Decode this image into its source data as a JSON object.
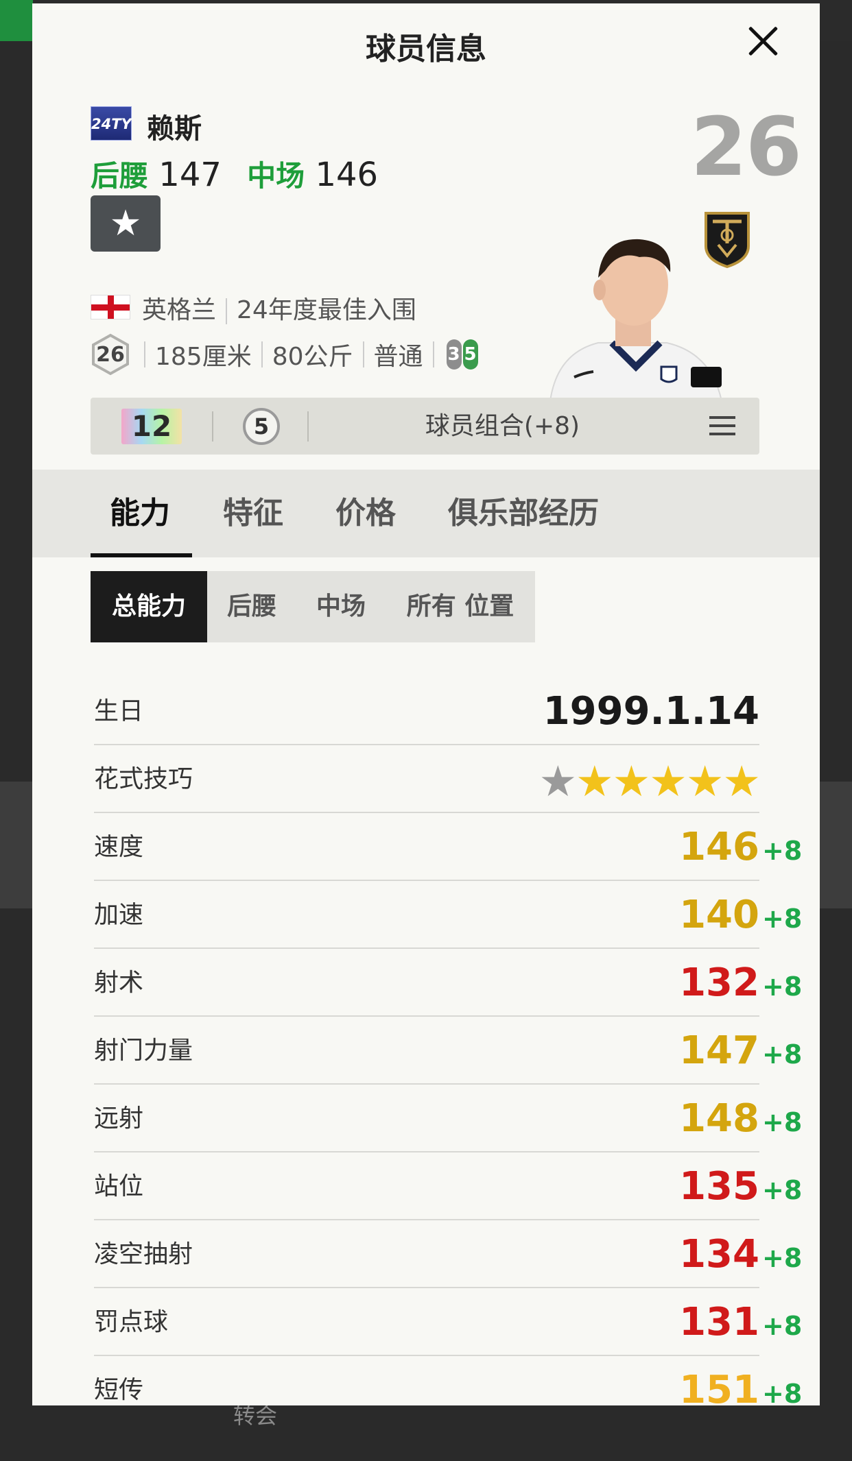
{
  "header": {
    "title": "球员信息"
  },
  "player": {
    "season_badge": "24TY",
    "name": "赖斯",
    "positions": [
      {
        "label": "后腰",
        "value": "147"
      },
      {
        "label": "中场",
        "value": "146"
      }
    ],
    "overall": "26",
    "nationality": "英格兰",
    "season_label": "24年度最佳入围",
    "level": "26",
    "height": "185厘米",
    "weight": "80公斤",
    "body_type": "普通",
    "weak_foot_left": "3",
    "weak_foot_right": "5"
  },
  "info_bar": {
    "upgrade_level": "12",
    "circle_value": "5",
    "combo_label": "球员组合(+8)"
  },
  "tabs": [
    "能力",
    "特征",
    "价格",
    "俱乐部经历"
  ],
  "subtabs": [
    "总能力",
    "后腰",
    "中场",
    "所有 位置"
  ],
  "stats": [
    {
      "label": "生日",
      "value": "1999.1.14",
      "color": "#1a1a1a"
    },
    {
      "label": "花式技巧",
      "stars": 5,
      "max_stars": 6
    },
    {
      "label": "速度",
      "value": "146",
      "bonus": "+8",
      "color": "#d4a50e"
    },
    {
      "label": "加速",
      "value": "140",
      "bonus": "+8",
      "color": "#d4a50e"
    },
    {
      "label": "射术",
      "value": "132",
      "bonus": "+8",
      "color": "#d01a1a"
    },
    {
      "label": "射门力量",
      "value": "147",
      "bonus": "+8",
      "color": "#d4a50e"
    },
    {
      "label": "远射",
      "value": "148",
      "bonus": "+8",
      "color": "#d4a50e"
    },
    {
      "label": "站位",
      "value": "135",
      "bonus": "+8",
      "color": "#d01a1a"
    },
    {
      "label": "凌空抽射",
      "value": "134",
      "bonus": "+8",
      "color": "#d01a1a"
    },
    {
      "label": "罚点球",
      "value": "131",
      "bonus": "+8",
      "color": "#d01a1a"
    },
    {
      "label": "短传",
      "value": "151",
      "bonus": "+8",
      "color": "#f0b020"
    }
  ],
  "background": {
    "footer_text": "转会"
  },
  "colors": {
    "position_green": "#1e9e3a",
    "bonus_green": "#1ea84a",
    "star_gold": "#f2c21b"
  }
}
